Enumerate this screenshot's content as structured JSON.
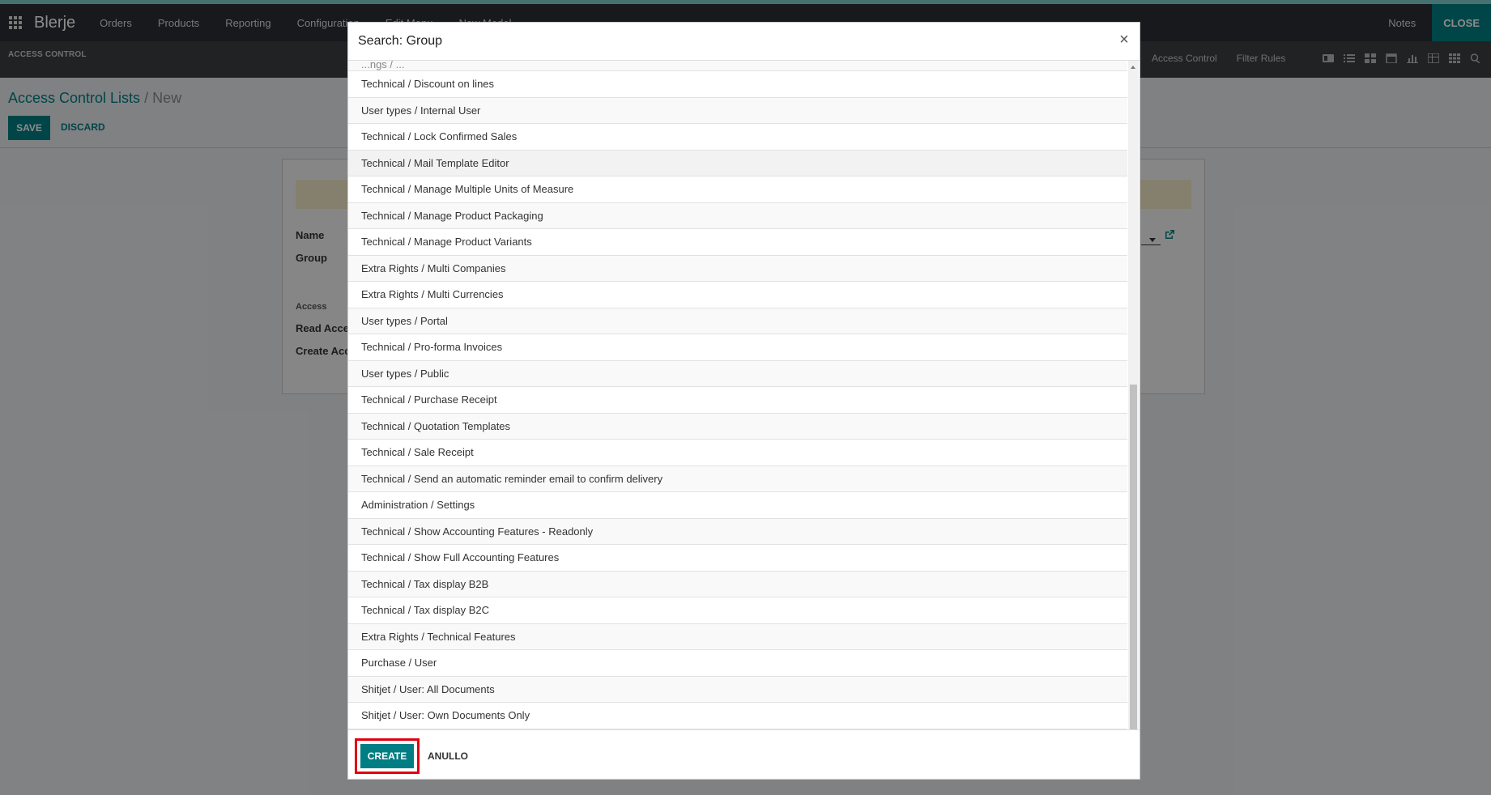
{
  "navbar": {
    "brand": "Blerje",
    "menu": [
      "Orders",
      "Products",
      "Reporting",
      "Configuration",
      "Edit Menu",
      "New Model"
    ],
    "notes": "Notes",
    "close": "CLOSE"
  },
  "subbar": {
    "section": "ACCESS CONTROL",
    "links": [
      "Access Control",
      "Filter Rules"
    ]
  },
  "breadcrumb": {
    "parent": "Access Control Lists",
    "current": " / New"
  },
  "actions": {
    "save": "SAVE",
    "discard": "DISCARD"
  },
  "form": {
    "name_label": "Name",
    "group_label": "Group",
    "access_label": "Access",
    "read_access_label": "Read Acces",
    "create_access_label": "Create Acc"
  },
  "modal": {
    "title": "Search: Group",
    "close_symbol": "×",
    "partial_row": "...ngs / ...",
    "rows": [
      "Technical / Discount on lines",
      "User types / Internal User",
      "Technical / Lock Confirmed Sales",
      "Technical / Mail Template Editor",
      "Technical / Manage Multiple Units of Measure",
      "Technical / Manage Product Packaging",
      "Technical / Manage Product Variants",
      "Extra Rights / Multi Companies",
      "Extra Rights / Multi Currencies",
      "User types / Portal",
      "Technical / Pro-forma Invoices",
      "User types / Public",
      "Technical / Purchase Receipt",
      "Technical / Quotation Templates",
      "Technical / Sale Receipt",
      "Technical / Send an automatic reminder email to confirm delivery",
      "Administration / Settings",
      "Technical / Show Accounting Features - Readonly",
      "Technical / Show Full Accounting Features",
      "Technical / Tax display B2B",
      "Technical / Tax display B2C",
      "Extra Rights / Technical Features",
      "Purchase / User",
      "Shitjet / User: All Documents",
      "Shitjet / User: Own Documents Only"
    ],
    "create": "CREATE",
    "cancel": "ANULLO"
  }
}
